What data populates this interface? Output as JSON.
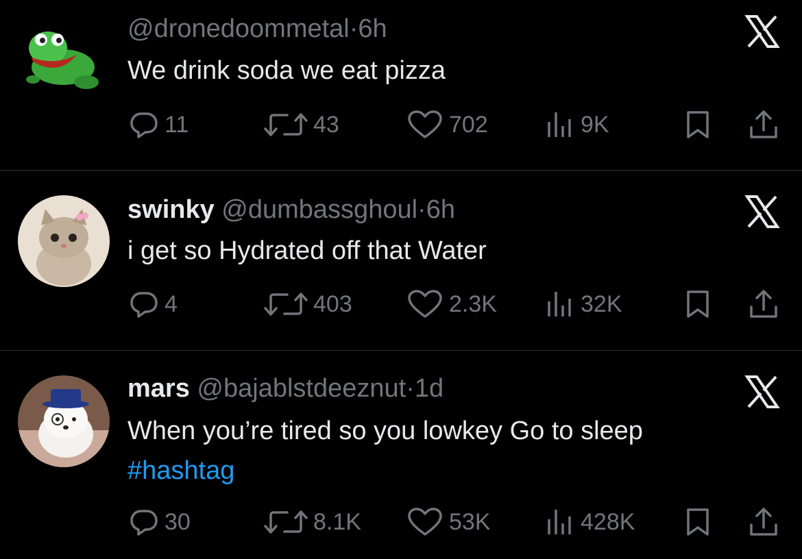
{
  "tweets": [
    {
      "display_name": "",
      "handle": "@dronedoommetal",
      "separator": "·",
      "time": "6h",
      "text": "We drink soda we eat pizza",
      "hashtag": "",
      "avatar": "frog-avatar",
      "counts": {
        "replies": "11",
        "reposts": "43",
        "likes": "702",
        "views": "9K"
      }
    },
    {
      "display_name": "swinky",
      "handle": "@dumbassghoul",
      "separator": "·",
      "time": "6h",
      "text": "i get so Hydrated off that Water",
      "hashtag": "",
      "avatar": "kitten-avatar",
      "counts": {
        "replies": "4",
        "reposts": "403",
        "likes": "2.3K",
        "views": "32K"
      }
    },
    {
      "display_name": "mars",
      "handle": "@bajablstdeeznut",
      "separator": "·",
      "time": "1d",
      "text": "When you’re tired so you lowkey Go to sleep",
      "hashtag": "#hashtag",
      "avatar": "dog-avatar",
      "counts": {
        "replies": "30",
        "reposts": "8.1K",
        "likes": "53K",
        "views": "428K"
      }
    }
  ],
  "icons": {
    "reply": "reply-icon",
    "repost": "repost-icon",
    "like": "heart-icon",
    "views": "views-icon",
    "bookmark": "bookmark-icon",
    "share": "share-icon",
    "brand": "x-logo-icon"
  },
  "colors": {
    "background": "#000000",
    "text": "#e7e9ea",
    "muted": "#71767b",
    "link": "#1d9bf0",
    "divider": "#2f3336"
  }
}
